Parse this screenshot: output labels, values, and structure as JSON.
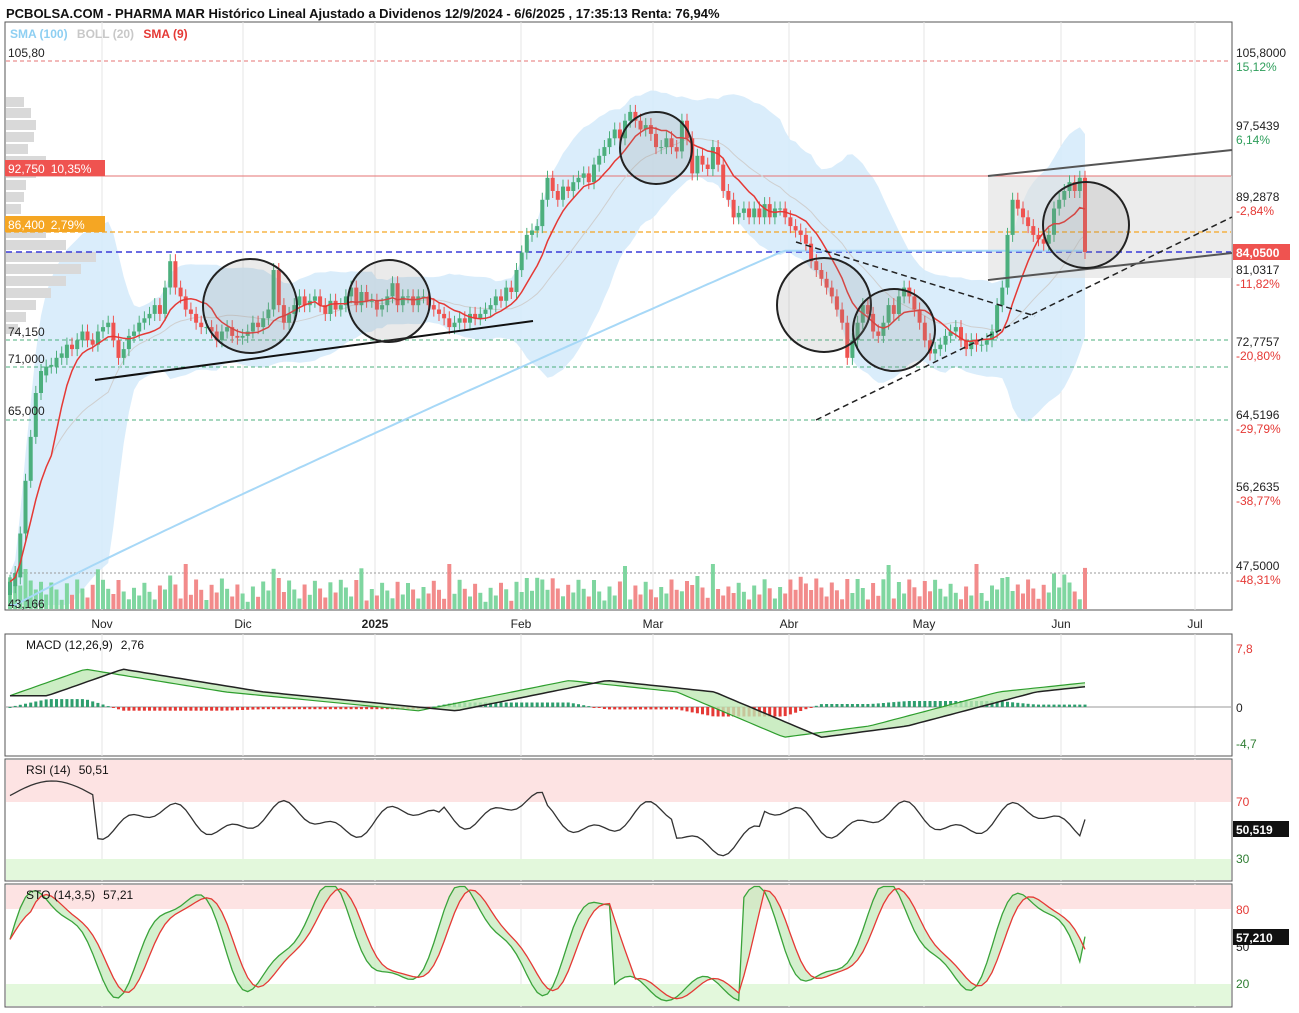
{
  "title": "PCBOLSA.COM - PHARMA MAR Histórico Lineal Ajustado a Dividenos 12/9/2024 - 6/6/2025 , 17:35:13 Renta: 76,94%",
  "legend": {
    "sma100": "SMA (100)",
    "boll": "BOLL (20)",
    "sma9": "SMA (9)",
    "colors": {
      "sma100": "#8ecff2",
      "boll": "#c8c8c8",
      "sma9": "#e53935"
    }
  },
  "colors": {
    "up": "#4caf7d",
    "down": "#ef5350",
    "boll_fill": "#d7ecfb",
    "sma100": "#9ed3f5",
    "sma9": "#e53935",
    "price_line": "#3a3ad8",
    "resistance": "#e57373",
    "orange": "#f5a623"
  },
  "left_labels": {
    "top": "105,80",
    "red": "92,750",
    "red_pct": "10,35%",
    "orange": "86,400",
    "orange_pct": "2,79%",
    "l74": "74,150",
    "l71": "71,000",
    "l65": "65,000",
    "bottom": "43,166"
  },
  "chart_data": [
    {
      "type": "candlestick",
      "title": "PHARMA MAR",
      "x_ticks": [
        "Nov",
        "Dic",
        "2025",
        "Feb",
        "Mar",
        "Abr",
        "May",
        "Jun",
        "Jul"
      ],
      "y_range": [
        43.166,
        105.8
      ],
      "y_axis": [
        {
          "value": "105,8000",
          "pct": "15,12%",
          "sign": "pos"
        },
        {
          "value": "97,5439",
          "pct": "6,14%",
          "sign": "pos"
        },
        {
          "value": "89,2878",
          "pct": "-2,84%",
          "sign": "neg"
        },
        {
          "value": "81,0317",
          "pct": "-11,82%",
          "sign": "neg"
        },
        {
          "value": "72,7757",
          "pct": "-20,80%",
          "sign": "neg"
        },
        {
          "value": "64,5196",
          "pct": "-29,79%",
          "sign": "neg"
        },
        {
          "value": "56,2635",
          "pct": "-38,77%",
          "sign": "neg"
        },
        {
          "value": "47,5000",
          "pct": "-48,31%",
          "sign": "neg"
        }
      ],
      "last_price": "84,0500",
      "levels": [
        105.8,
        92.75,
        86.4,
        84.05,
        74.15,
        71.0,
        65.0,
        47.5
      ],
      "closes": [
        46.5,
        47.5,
        52,
        58,
        63,
        68,
        70.5,
        71,
        71.2,
        72,
        72.5,
        73.5,
        73,
        74,
        75,
        74,
        73.5,
        75,
        75.5,
        76,
        74,
        72,
        73,
        74.5,
        75,
        76,
        76.5,
        77,
        78,
        77,
        80,
        83,
        80,
        79,
        77.5,
        77,
        76,
        75.5,
        75.5,
        75,
        74,
        75,
        75.5,
        74.5,
        74.3,
        74.5,
        75,
        76,
        75.5,
        76.5,
        77.5,
        82,
        78,
        76,
        77,
        78,
        79,
        78,
        78.5,
        79,
        78,
        77,
        78.5,
        77.5,
        78,
        79,
        80,
        78,
        79.5,
        78.5,
        78.5,
        77.5,
        78,
        79,
        80.5,
        78,
        79,
        79,
        78,
        79,
        79,
        78,
        77.5,
        77,
        76.5,
        75.5,
        76,
        76.5,
        76,
        77,
        76.5,
        77,
        77.5,
        78,
        79,
        78.5,
        80,
        79.5,
        82,
        84,
        86,
        86.5,
        87,
        90,
        92.5,
        91,
        90,
        91.5,
        91,
        92,
        92.5,
        93,
        92,
        94,
        95,
        96,
        97,
        98,
        97,
        99,
        100,
        99,
        98,
        98.5,
        97.5,
        96,
        96,
        97,
        96,
        95.5,
        99,
        97,
        93,
        95,
        94,
        93.5,
        96,
        94,
        91,
        90,
        88,
        88.5,
        89,
        88,
        89,
        88,
        89.5,
        88,
        89,
        89,
        88,
        87,
        86.5,
        86,
        85,
        83,
        82,
        81,
        80,
        79,
        77.5,
        76,
        72,
        74,
        76,
        78,
        77,
        75,
        74.5,
        76,
        78,
        77,
        79,
        80,
        79,
        77.5,
        76,
        74,
        72.5,
        73,
        73.5,
        74.5,
        75,
        75.5,
        74,
        73,
        74,
        73.5,
        73.5,
        74,
        75,
        78,
        80,
        86,
        90,
        89,
        88,
        87,
        86,
        85.5,
        85,
        86,
        89,
        90,
        91,
        92,
        91,
        92.5,
        84.05
      ],
      "opens": [
        45,
        46,
        47,
        52,
        58,
        63,
        68,
        70,
        71,
        71,
        72,
        72,
        73.5,
        73,
        74,
        75,
        74,
        73.5,
        75,
        75.5,
        76,
        74,
        72,
        73,
        74.5,
        75,
        76,
        76.5,
        77,
        78,
        77,
        80,
        83,
        80,
        79,
        77.5,
        77,
        76,
        75.5,
        75.5,
        75,
        74,
        75,
        75.5,
        74.5,
        74.3,
        74.5,
        75,
        76,
        75.5,
        76.5,
        77.5,
        82,
        78,
        76,
        77,
        78,
        79,
        78,
        78.5,
        79,
        78,
        77,
        78.5,
        77.5,
        78,
        79,
        80,
        78,
        79.5,
        78.5,
        78.5,
        77.5,
        78,
        79,
        80.5,
        78,
        79,
        79,
        78,
        79,
        79,
        78,
        77.5,
        77,
        76.5,
        75.5,
        76,
        76.5,
        76,
        77,
        76.5,
        77,
        77.5,
        78,
        79,
        78.5,
        80,
        79.5,
        82,
        84,
        86,
        86.5,
        87,
        90,
        92.5,
        91,
        90,
        91.5,
        91,
        92,
        92.5,
        93,
        92,
        94,
        95,
        96,
        97,
        98,
        97,
        99,
        100,
        99,
        98,
        98.5,
        97.5,
        96,
        96,
        97,
        96,
        95.5,
        99,
        97,
        93,
        95,
        94,
        93.5,
        96,
        94,
        91,
        90,
        88,
        88.5,
        89,
        88,
        89,
        88,
        89.5,
        88,
        89,
        89,
        88,
        87,
        86.5,
        86,
        85,
        83,
        82,
        81,
        80,
        79,
        77.5,
        76,
        72,
        74,
        76,
        78,
        77,
        75,
        74.5,
        76,
        78,
        77,
        79,
        80,
        79,
        77.5,
        76,
        74,
        72.5,
        73,
        73.5,
        74.5,
        75,
        75.5,
        74,
        73,
        74,
        73.5,
        73.5,
        74,
        75,
        78,
        80,
        86,
        90,
        89,
        88,
        87,
        86,
        85.5,
        85,
        86,
        89,
        90,
        91,
        92,
        91,
        92.5
      ]
    },
    {
      "type": "line",
      "title": "MACD (12,26,9)",
      "value_label": "2,76",
      "y_ticks": [
        "7,8",
        "0",
        "-4,7"
      ],
      "y_range": [
        -4.7,
        7.8
      ]
    },
    {
      "type": "line",
      "title": "RSI (14)",
      "value_label": "50,51",
      "last_value": "50,519",
      "y_ticks": [
        "70",
        "30"
      ],
      "y_range": [
        0,
        100
      ]
    },
    {
      "type": "line",
      "title": "STO (14,3,5)",
      "value_label": "57,21",
      "last_value": "57,210",
      "y_ticks": [
        "80",
        "50",
        "20"
      ],
      "y_range": [
        0,
        100
      ]
    }
  ]
}
